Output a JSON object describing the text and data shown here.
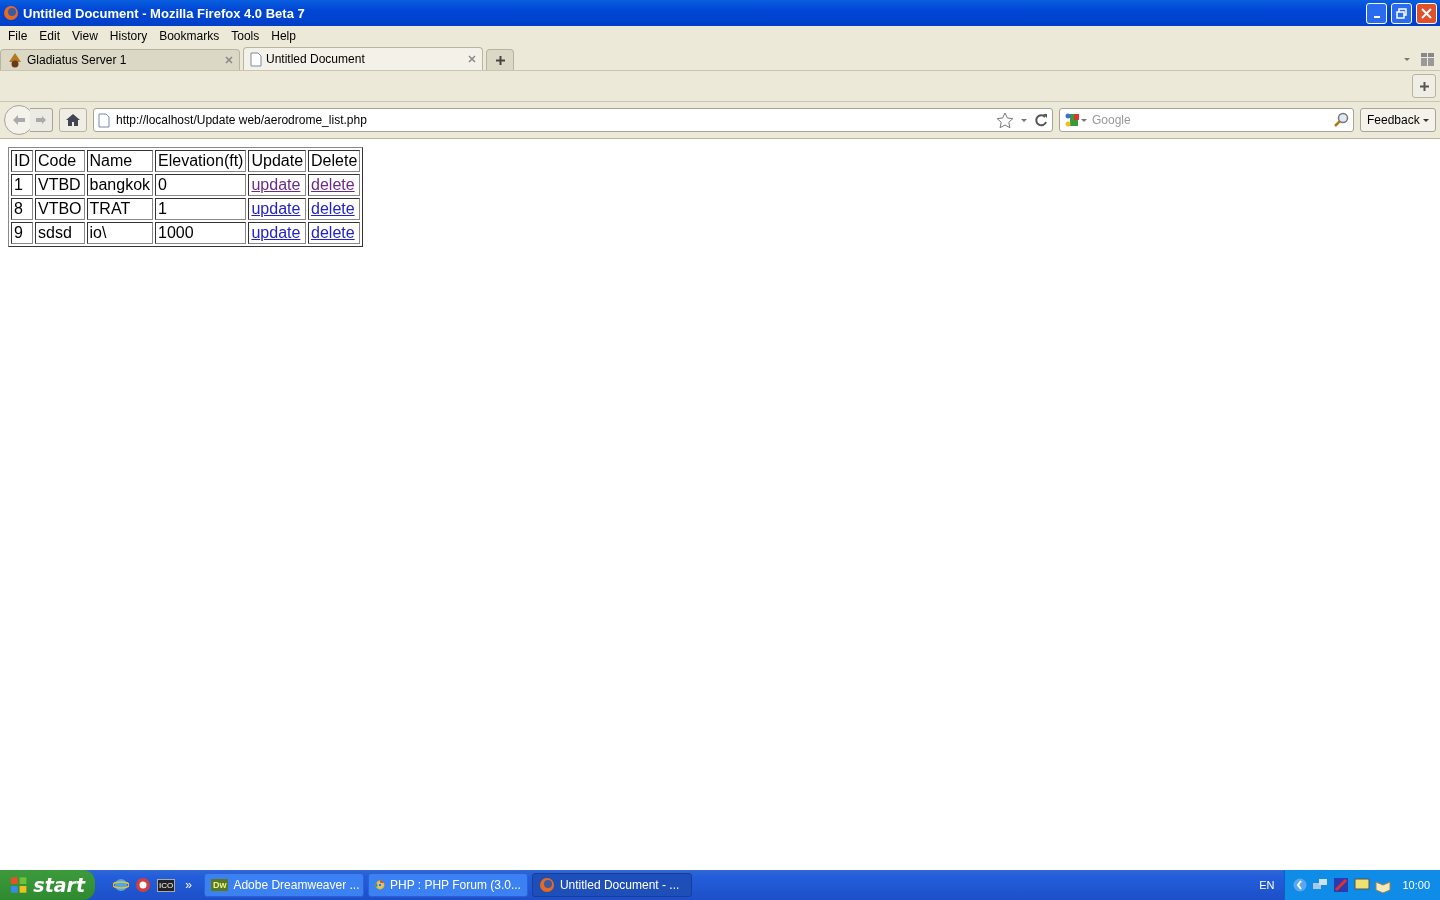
{
  "window": {
    "title": "Untitled Document - Mozilla Firefox 4.0 Beta 7"
  },
  "menu": [
    "File",
    "Edit",
    "View",
    "History",
    "Bookmarks",
    "Tools",
    "Help"
  ],
  "tabs": [
    {
      "label": "Gladiatus Server 1",
      "selected": false,
      "kind": "helmet"
    },
    {
      "label": "Untitled Document",
      "selected": true,
      "kind": "page"
    }
  ],
  "address": {
    "value": "http://localhost/Update web/aerodrome_list.php"
  },
  "search": {
    "placeholder": "Google"
  },
  "feedback_button": "Feedback",
  "table": {
    "columns": [
      "ID",
      "Code",
      "Name",
      "Elevation(ft)",
      "Update",
      "Delete"
    ],
    "rows": [
      {
        "id": "1",
        "code": "VTBD",
        "name": "bangkok",
        "elevation": "0",
        "update": {
          "label": "update",
          "visited": true
        },
        "delete": {
          "label": "delete",
          "visited": true
        }
      },
      {
        "id": "8",
        "code": "VTBO",
        "name": "TRAT",
        "elevation": "1",
        "update": {
          "label": "update",
          "visited": false
        },
        "delete": {
          "label": "delete",
          "visited": false
        }
      },
      {
        "id": "9",
        "code": "sdsd",
        "name": "io\\",
        "elevation": "1000",
        "update": {
          "label": "update",
          "visited": false
        },
        "delete": {
          "label": "delete",
          "visited": false
        }
      }
    ]
  },
  "taskbar": {
    "start": "start",
    "quick_launch": [
      {
        "kind": "globe"
      },
      {
        "kind": "ring"
      },
      {
        "kind": "label",
        "text": "ICO"
      }
    ],
    "more": "»",
    "buttons": [
      {
        "label": "Adobe Dreamweaver ...",
        "icon": "Dw",
        "kind": "text",
        "selected": false
      },
      {
        "label": "PHP : PHP Forum (3.0...",
        "kind": "chrome",
        "selected": false
      },
      {
        "label": "Untitled Document - ...",
        "kind": "firefox",
        "selected": true
      }
    ],
    "language": "EN",
    "clock": "10:00"
  }
}
